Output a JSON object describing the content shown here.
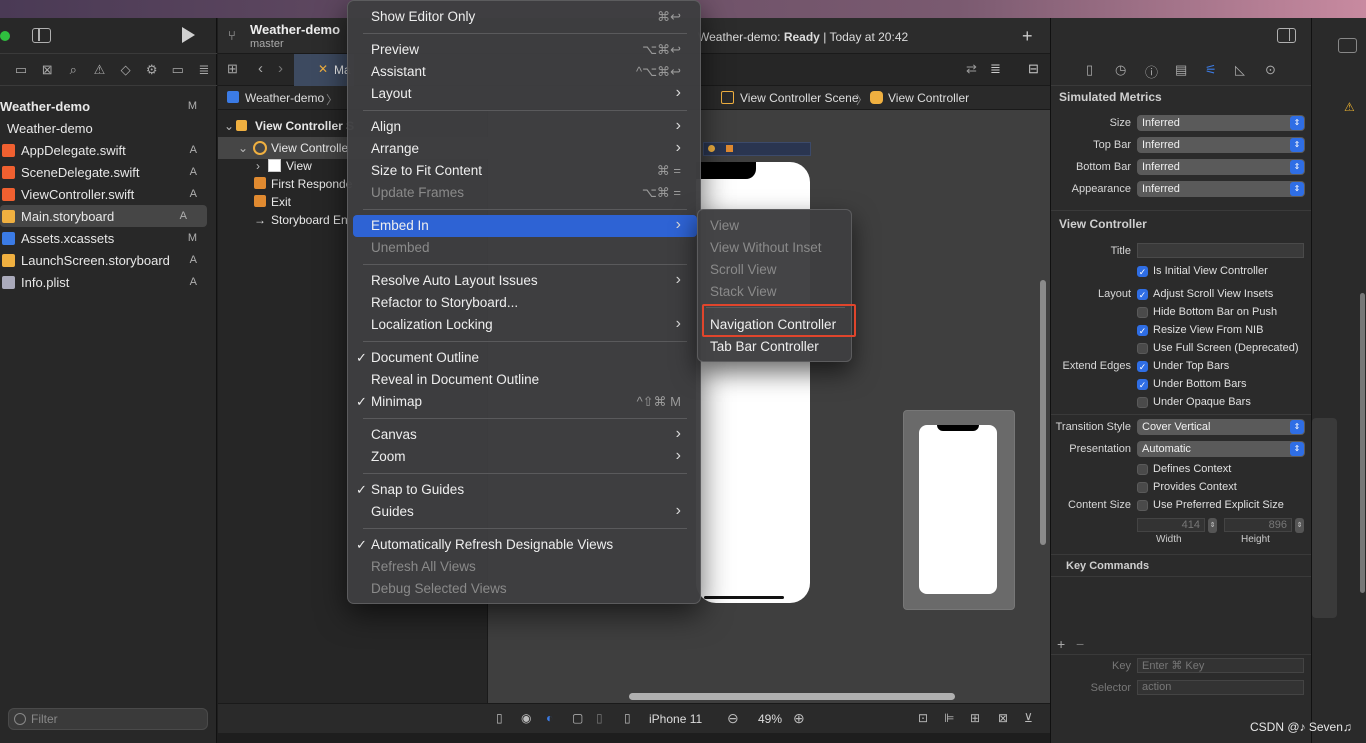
{
  "window": {
    "scheme_name": "Weather-demo",
    "branch": "master",
    "status_project": "Weather-demo:",
    "status_state": "Ready",
    "status_time": "| Today at 20:42"
  },
  "navigator": {
    "project_label": "Weather-demo",
    "project_badge": "M",
    "group_label": "Weather-demo",
    "files": [
      {
        "name": "AppDelegate.swift",
        "badge": "A"
      },
      {
        "name": "SceneDelegate.swift",
        "badge": "A"
      },
      {
        "name": "ViewController.swift",
        "badge": "A"
      },
      {
        "name": "Main.storyboard",
        "badge": "A"
      },
      {
        "name": "Assets.xcassets",
        "badge": "M"
      },
      {
        "name": "LaunchScreen.storyboard",
        "badge": "A"
      },
      {
        "name": "Info.plist",
        "badge": "A"
      }
    ],
    "filter_placeholder": "Filter"
  },
  "editor": {
    "tab_label": "Ma",
    "jump_bar": [
      "Weather-demo",
      "View Controller Scene",
      "View Controller"
    ],
    "outline": {
      "scene": "View Controller S",
      "controller": "View Controlle",
      "view": "View",
      "first_responder": "First Responde",
      "exit": "Exit",
      "entry": "Storyboard En"
    },
    "device": "iPhone 11",
    "zoom": "49%"
  },
  "context_menu": {
    "items": [
      {
        "label": "Show Editor Only",
        "shortcut": "⌘↩",
        "enabled": true
      },
      {
        "label": "Preview",
        "shortcut": "⌥⌘↩",
        "enabled": true
      },
      {
        "label": "Assistant",
        "shortcut": "^⌥⌘↩",
        "enabled": true
      },
      {
        "label": "Layout",
        "shortcut": "›",
        "enabled": true
      },
      {
        "label": "Align",
        "shortcut": "›",
        "enabled": true
      },
      {
        "label": "Arrange",
        "shortcut": "›",
        "enabled": true
      },
      {
        "label": "Size to Fit Content",
        "shortcut": "⌘ =",
        "enabled": true
      },
      {
        "label": "Update Frames",
        "shortcut": "⌥⌘ =",
        "enabled": false
      },
      {
        "label": "Embed In",
        "shortcut": "›",
        "enabled": true,
        "highlighted": true
      },
      {
        "label": "Unembed",
        "shortcut": "",
        "enabled": false
      },
      {
        "label": "Resolve Auto Layout Issues",
        "shortcut": "›",
        "enabled": true
      },
      {
        "label": "Refactor to Storyboard...",
        "shortcut": "",
        "enabled": true
      },
      {
        "label": "Localization Locking",
        "shortcut": "›",
        "enabled": true
      },
      {
        "label": "Document Outline",
        "shortcut": "",
        "enabled": true,
        "checked": true
      },
      {
        "label": "Reveal in Document Outline",
        "shortcut": "",
        "enabled": true
      },
      {
        "label": "Minimap",
        "shortcut": "^⇧⌘ M",
        "enabled": true,
        "checked": true
      },
      {
        "label": "Canvas",
        "shortcut": "›",
        "enabled": true
      },
      {
        "label": "Zoom",
        "shortcut": "›",
        "enabled": true
      },
      {
        "label": "Snap to Guides",
        "shortcut": "",
        "enabled": true,
        "checked": true
      },
      {
        "label": "Guides",
        "shortcut": "›",
        "enabled": true
      },
      {
        "label": "Automatically Refresh Designable Views",
        "shortcut": "",
        "enabled": true,
        "checked": true
      },
      {
        "label": "Refresh All Views",
        "shortcut": "",
        "enabled": false
      },
      {
        "label": "Debug Selected Views",
        "shortcut": "",
        "enabled": false
      }
    ],
    "check_mark": "✓"
  },
  "embed_submenu": {
    "items": [
      {
        "label": "View",
        "enabled": false
      },
      {
        "label": "View Without Inset",
        "enabled": false
      },
      {
        "label": "Scroll View",
        "enabled": false
      },
      {
        "label": "Stack View",
        "enabled": false
      },
      {
        "label": "Navigation Controller",
        "enabled": true
      },
      {
        "label": "Tab Bar Controller",
        "enabled": true
      }
    ]
  },
  "inspector": {
    "simulated_metrics_title": "Simulated Metrics",
    "metrics": [
      {
        "label": "Size",
        "value": "Inferred"
      },
      {
        "label": "Top Bar",
        "value": "Inferred"
      },
      {
        "label": "Bottom Bar",
        "value": "Inferred"
      },
      {
        "label": "Appearance",
        "value": "Inferred"
      }
    ],
    "view_controller_title": "View Controller",
    "title_label": "Title",
    "title_value": "",
    "is_initial": "Is Initial View Controller",
    "layout_label": "Layout",
    "layout_checks": [
      {
        "label": "Adjust Scroll View Insets",
        "checked": true
      },
      {
        "label": "Hide Bottom Bar on Push",
        "checked": false
      },
      {
        "label": "Resize View From NIB",
        "checked": true
      },
      {
        "label": "Use Full Screen (Deprecated)",
        "checked": false
      }
    ],
    "extend_edges_label": "Extend Edges",
    "extend_checks": [
      {
        "label": "Under Top Bars",
        "checked": true
      },
      {
        "label": "Under Bottom Bars",
        "checked": true
      },
      {
        "label": "Under Opaque Bars",
        "checked": false
      }
    ],
    "transition_label": "Transition Style",
    "transition_value": "Cover Vertical",
    "presentation_label": "Presentation",
    "presentation_value": "Automatic",
    "defines_context": "Defines Context",
    "provides_context": "Provides Context",
    "content_size_label": "Content Size",
    "preferred_size": "Use Preferred Explicit Size",
    "width_value": "414",
    "height_value": "896",
    "width_label": "Width",
    "height_label": "Height",
    "key_commands_title": "Key Commands",
    "key_label": "Key",
    "key_placeholder": "Enter ⌘ Key",
    "selector_label": "Selector",
    "selector_placeholder": "action"
  },
  "watermark": "CSDN @♪ Seven♫",
  "colors": {
    "accent": "#2f6ee5",
    "highlight": "#2e63d4",
    "callout": "#e0452c"
  }
}
